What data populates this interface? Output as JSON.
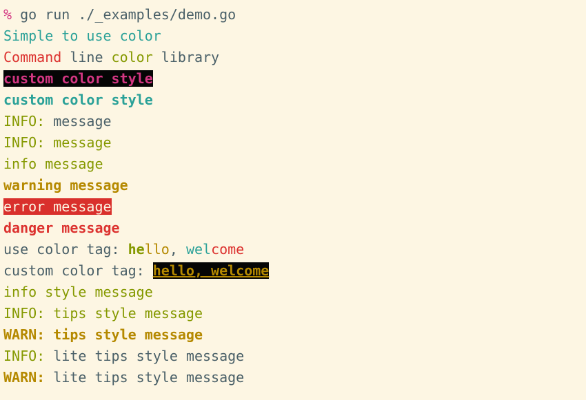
{
  "colors": {
    "background": "#fdf6e3",
    "text": "#4a6068",
    "cyan": "#2aa198",
    "red": "#dc322f",
    "green": "#859900",
    "yellow": "#b58900",
    "magenta": "#d33682",
    "black": "#050505"
  },
  "lines": [
    [
      {
        "t": "% ",
        "c": "#d33682"
      },
      {
        "t": "go run ./_examples/demo.go"
      }
    ],
    [
      {
        "t": "Simple to use color",
        "c": "#2aa198"
      }
    ],
    [
      {
        "t": "Command",
        "c": "#dc322f"
      },
      {
        "t": " line "
      },
      {
        "t": "color",
        "c": "#859900"
      },
      {
        "t": " library"
      }
    ],
    [
      {
        "t": "custom color style",
        "c": "#d33682",
        "s": "b bgblack"
      }
    ],
    [
      {
        "t": "custom color style",
        "c": "#2aa198",
        "s": "b"
      }
    ],
    [
      {
        "t": "INFO:",
        "c": "#859900"
      },
      {
        "t": " message"
      }
    ],
    [
      {
        "t": "INFO: message",
        "c": "#859900"
      }
    ],
    [
      {
        "t": "info message",
        "c": "#859900"
      }
    ],
    [
      {
        "t": "warning message",
        "c": "#b58900",
        "s": "b"
      }
    ],
    [
      {
        "t": "error message",
        "s": "bgred"
      }
    ],
    [
      {
        "t": "danger message",
        "c": "#dc322f",
        "s": "b"
      }
    ],
    [
      {
        "t": "use color tag: "
      },
      {
        "t": "he",
        "c": "#859900",
        "s": "b"
      },
      {
        "t": "llo",
        "c": "#b58900"
      },
      {
        "t": ", "
      },
      {
        "t": "wel",
        "c": "#2aa198"
      },
      {
        "t": "come",
        "c": "#dc322f"
      }
    ],
    [
      {
        "t": "custom color tag: "
      },
      {
        "t": "hello, welcome",
        "c": "#b58900",
        "s": "b u bgblack"
      }
    ],
    [
      {
        "t": "info style message",
        "c": "#859900"
      }
    ],
    [
      {
        "t": "INFO: tips style message",
        "c": "#859900"
      }
    ],
    [
      {
        "t": "WARN: tips style message",
        "c": "#b58900",
        "s": "b"
      }
    ],
    [
      {
        "t": "INFO:",
        "c": "#859900"
      },
      {
        "t": " lite tips style message"
      }
    ],
    [
      {
        "t": "WARN:",
        "c": "#b58900",
        "s": "b"
      },
      {
        "t": " lite tips style message"
      }
    ]
  ]
}
